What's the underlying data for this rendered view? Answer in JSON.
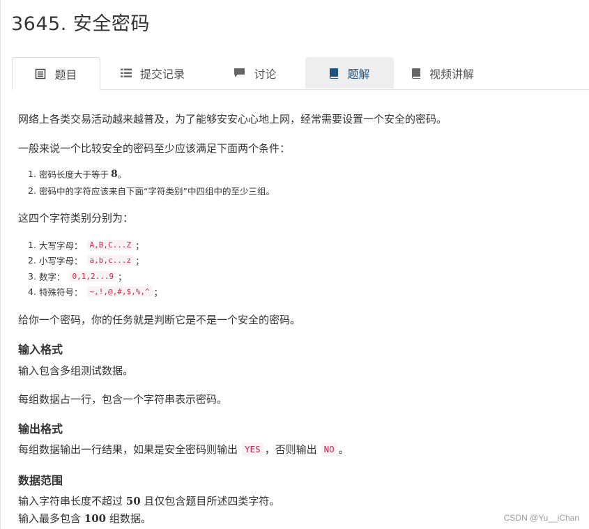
{
  "page": {
    "title": "3645. 安全密码"
  },
  "tabs": [
    {
      "label": "题目",
      "icon": "document-icon"
    },
    {
      "label": "提交记录",
      "icon": "list-icon"
    },
    {
      "label": "讨论",
      "icon": "chat-icon"
    },
    {
      "label": "题解",
      "icon": "book-icon"
    },
    {
      "label": "视频讲解",
      "icon": "book-icon"
    }
  ],
  "problem": {
    "intro": "网络上各类交易活动越来越普及，为了能够安安心心地上网，经常需要设置一个安全的密码。",
    "conditions_lead": "一般来说一个比较安全的密码至少应该满足下面两个条件：",
    "conditions": [
      {
        "num": "1.",
        "text": "密码长度大于等于 ",
        "value": "8",
        "end": "。"
      },
      {
        "num": "2.",
        "text": "密码中的字符应该来自下面“字符类别”中四组中的至少三组。"
      }
    ],
    "categories_lead": "这四个字符类别分别为：",
    "categories": [
      {
        "num": "1.",
        "label": "大写字母：",
        "code": "A,B,C...Z",
        "end": "；"
      },
      {
        "num": "2.",
        "label": "小写字母：",
        "code": "a,b,c...z",
        "end": "；"
      },
      {
        "num": "3.",
        "label": "数字：",
        "code": "0,1,2...9",
        "end": "；"
      },
      {
        "num": "4.",
        "label": "特殊符号：",
        "code": "~,!,@,#,$,%,^",
        "end": "；"
      }
    ],
    "task": "给你一个密码，你的任务就是判断它是不是一个安全的密码。",
    "input_heading": "输入格式",
    "input_p1": "输入包含多组测试数据。",
    "input_p2": "每组数据占一行，包含一个字符串表示密码。",
    "output_heading": "输出格式",
    "output_pre": "每组数据输出一行结果，如果是安全密码则输出",
    "output_yes": "YES",
    "output_mid": "，否则输出",
    "output_no": "NO",
    "output_end": "。",
    "range_heading": "数据范围",
    "range_1_pre": "输入字符串长度不超过 ",
    "range_1_num": "50",
    "range_1_post": " 且仅包含题目所述四类字符。",
    "range_2_pre": "输入最多包含 ",
    "range_2_num": "100",
    "range_2_post": " 组数据。"
  },
  "watermark": "CSDN @Yu__iChan"
}
